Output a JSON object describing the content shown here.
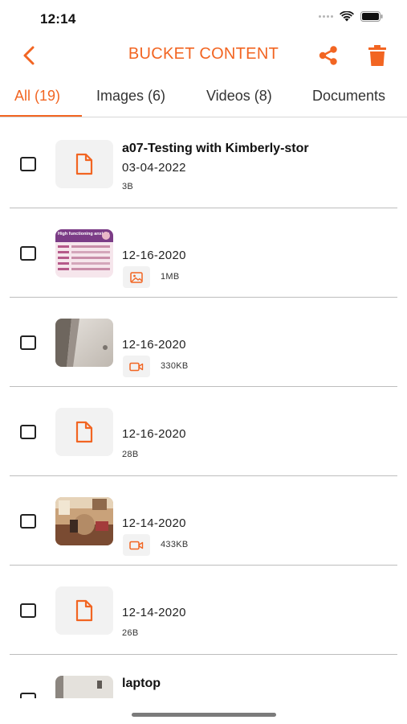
{
  "status_bar": {
    "time": "12:14"
  },
  "header": {
    "title": "BUCKET CONTENT"
  },
  "tabs": [
    {
      "label": "All (19)",
      "active": true
    },
    {
      "label": "Images (6)",
      "active": false
    },
    {
      "label": "Videos (8)",
      "active": false
    },
    {
      "label": "Documents",
      "active": false
    }
  ],
  "items": [
    {
      "kind": "document",
      "title": "a07-Testing with Kimberly-stor",
      "date": "03-04-2022",
      "size": "3B"
    },
    {
      "kind": "image",
      "title": "",
      "date": "12-16-2020",
      "size": "1MB",
      "thumbnail_text": "High functioning anxiety"
    },
    {
      "kind": "video",
      "title": "",
      "date": "12-16-2020",
      "size": "330KB"
    },
    {
      "kind": "document",
      "title": "",
      "date": "12-16-2020",
      "size": "28B"
    },
    {
      "kind": "video",
      "title": "",
      "date": "12-14-2020",
      "size": "433KB"
    },
    {
      "kind": "document",
      "title": "",
      "date": "12-14-2020",
      "size": "26B"
    },
    {
      "kind": "image",
      "title": "laptop",
      "date": "",
      "size": ""
    }
  ],
  "colors": {
    "accent": "#f26522",
    "divider": "#bdbdbd",
    "thumb_bg": "#f2f2f2"
  }
}
